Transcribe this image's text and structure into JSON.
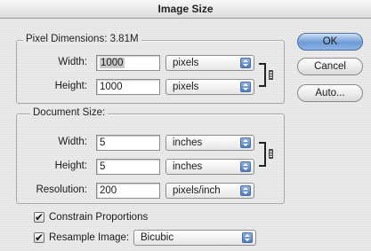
{
  "window": {
    "title": "Image Size"
  },
  "pixel_dimensions": {
    "legend": "Pixel Dimensions: ",
    "size": "3.81M",
    "width_label": "Width:",
    "width_value": "1000",
    "width_unit": "pixels",
    "height_label": "Height:",
    "height_value": "1000",
    "height_unit": "pixels"
  },
  "document_size": {
    "legend": "Document Size:",
    "width_label": "Width:",
    "width_value": "5",
    "width_unit": "inches",
    "height_label": "Height:",
    "height_value": "5",
    "height_unit": "inches",
    "resolution_label": "Resolution:",
    "resolution_value": "200",
    "resolution_unit": "pixels/inch"
  },
  "options": {
    "constrain_label": "Constrain Proportions",
    "constrain_checked": true,
    "resample_label": "Resample Image:",
    "resample_checked": true,
    "resample_method": "Bicubic"
  },
  "buttons": {
    "ok": "OK",
    "cancel": "Cancel",
    "auto": "Auto..."
  },
  "icons": {
    "check": "✔",
    "link": "chain-link-icon"
  }
}
